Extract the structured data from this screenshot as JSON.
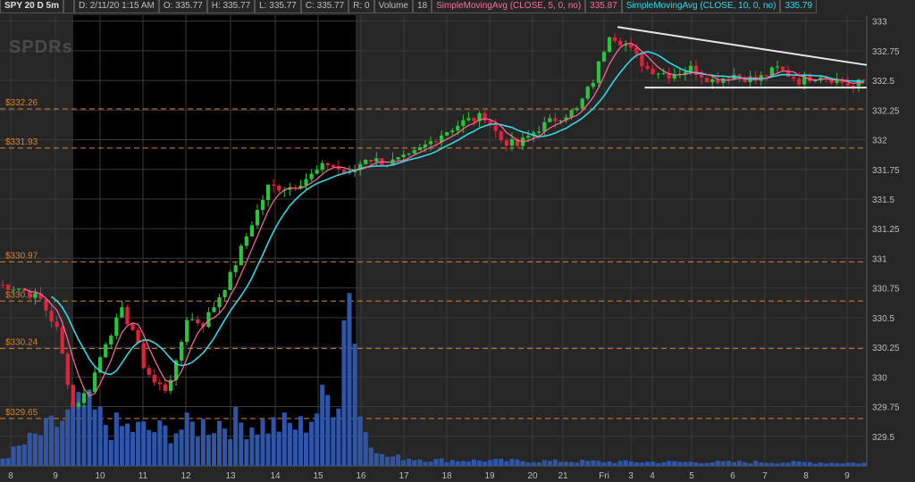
{
  "header": {
    "symbol": "SPY 20 D 5m",
    "datetime": "D: 2/11/20 1:15 AM",
    "open": "O: 335.77",
    "high": "H: 335.77",
    "low": "L: 335.77",
    "close": "C: 335.77",
    "range": "R: 0",
    "volume_label": "Volume",
    "volume_value": "18",
    "ma5_label": "SimpleMovingAvg (CLOSE, 5, 0, no)",
    "ma5_value": "335.87",
    "ma10_label": "SimpleMovingAvg (CLOSE, 10, 0, no)",
    "ma10_value": "335.79"
  },
  "watermark": "SPDRs",
  "colors": {
    "background": "#262626",
    "night_shade": "#000000",
    "grid": "#3a3a3a",
    "level_line": "#d9822b",
    "up_candle": "#29c43a",
    "down_candle": "#e0223f",
    "ma5": "#ff6b9a",
    "ma10": "#35d6e6",
    "volume": "#2e55a8",
    "trendline": "#e6e6e6",
    "axis_text": "#bdbdbd"
  },
  "chart_data": {
    "type": "candlestick",
    "y_axis": {
      "range": [
        329.25,
        333.05
      ],
      "ticks": [
        333,
        332.75,
        332.5,
        332.25,
        332,
        331.75,
        331.5,
        331.25,
        331,
        330.75,
        330.5,
        330.25,
        330,
        329.75,
        329.5
      ],
      "position": "right"
    },
    "x_ticks": [
      "8",
      "9",
      "10",
      "11",
      "12",
      "13",
      "14",
      "15",
      "16",
      "17",
      "18",
      "19",
      "20",
      "21",
      "Fri",
      "3",
      "4",
      "5",
      "6",
      "7",
      "8",
      "9"
    ],
    "levels": [
      332.26,
      331.93,
      330.97,
      330.64,
      330.24,
      329.65
    ],
    "level_labels": [
      "$332.26",
      "$331.93",
      "$330.97",
      "$330.64",
      "$330.24",
      "$329.65"
    ],
    "close_path": [
      [
        0,
        330.78
      ],
      [
        4,
        330.75
      ],
      [
        8,
        330.65
      ],
      [
        11,
        330.4
      ],
      [
        14,
        329.75
      ],
      [
        17,
        329.9
      ],
      [
        20,
        330.3
      ],
      [
        23,
        330.55
      ],
      [
        25,
        330.4
      ],
      [
        27,
        330.1
      ],
      [
        29,
        329.95
      ],
      [
        31,
        329.9
      ],
      [
        33,
        330.1
      ],
      [
        35,
        330.5
      ],
      [
        38,
        330.45
      ],
      [
        40,
        330.6
      ],
      [
        43,
        330.85
      ],
      [
        47,
        331.3
      ],
      [
        50,
        331.6
      ],
      [
        54,
        331.6
      ],
      [
        58,
        331.7
      ],
      [
        61,
        331.8
      ],
      [
        65,
        331.7
      ],
      [
        68,
        331.85
      ],
      [
        72,
        331.8
      ],
      [
        76,
        331.85
      ],
      [
        79,
        331.95
      ],
      [
        82,
        332.05
      ],
      [
        86,
        332.15
      ],
      [
        90,
        332.2
      ],
      [
        93,
        332.0
      ],
      [
        96,
        331.95
      ],
      [
        100,
        332.1
      ],
      [
        104,
        332.2
      ],
      [
        107,
        332.25
      ],
      [
        110,
        332.5
      ],
      [
        113,
        332.9
      ],
      [
        116,
        332.8
      ],
      [
        120,
        332.6
      ],
      [
        124,
        332.55
      ],
      [
        128,
        332.6
      ],
      [
        132,
        332.5
      ],
      [
        136,
        332.55
      ],
      [
        140,
        332.5
      ],
      [
        144,
        332.6
      ],
      [
        148,
        332.5
      ],
      [
        152,
        332.55
      ],
      [
        155,
        332.5
      ],
      [
        158,
        332.45
      ],
      [
        160,
        332.5
      ]
    ],
    "volume_path": [
      [
        0,
        8
      ],
      [
        15,
        60
      ],
      [
        20,
        40
      ],
      [
        30,
        35
      ],
      [
        40,
        45
      ],
      [
        55,
        40
      ],
      [
        62,
        80
      ],
      [
        64,
        220
      ],
      [
        66,
        50
      ],
      [
        70,
        10
      ],
      [
        80,
        6
      ],
      [
        100,
        5
      ],
      [
        120,
        4
      ],
      [
        140,
        4
      ],
      [
        160,
        3
      ]
    ],
    "trendlines": [
      {
        "from": [
          114,
          332.95
        ],
        "to": [
          160,
          332.63
        ]
      },
      {
        "from": [
          119,
          332.44
        ],
        "to": [
          160,
          332.44
        ]
      }
    ],
    "grid": true,
    "legend": "top-left"
  }
}
